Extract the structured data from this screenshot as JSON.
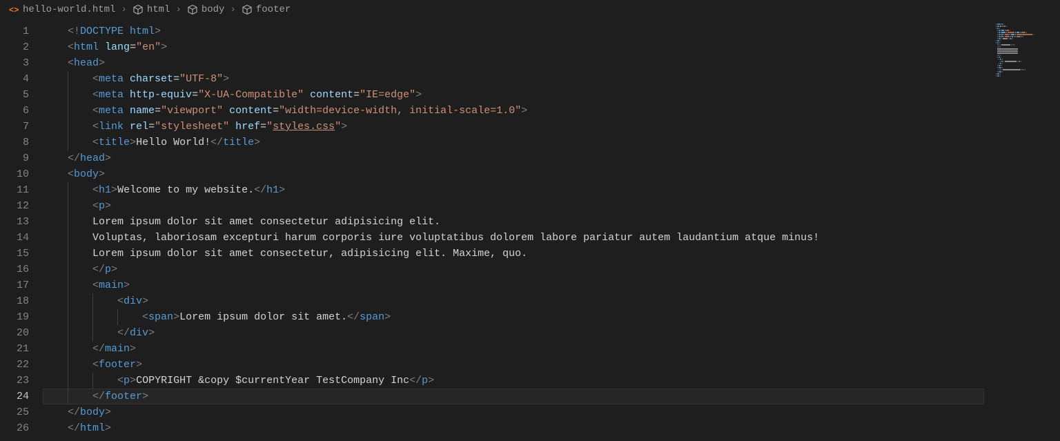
{
  "breadcrumb": {
    "file": "hello-world.html",
    "path": [
      "html",
      "body",
      "footer"
    ]
  },
  "lines": [
    {
      "n": 1,
      "indent": 0,
      "tokens": [
        [
          "<!",
          "gray"
        ],
        [
          "DOCTYPE ",
          "doctype"
        ],
        [
          "html",
          "blue"
        ],
        [
          ">",
          "gray"
        ]
      ]
    },
    {
      "n": 2,
      "indent": 0,
      "tokens": [
        [
          "<",
          "gray"
        ],
        [
          "html ",
          "blue"
        ],
        [
          "lang",
          "lblue"
        ],
        [
          "=",
          "text"
        ],
        [
          "\"en\"",
          "orange"
        ],
        [
          ">",
          "gray"
        ]
      ]
    },
    {
      "n": 3,
      "indent": 0,
      "tokens": [
        [
          "<",
          "gray"
        ],
        [
          "head",
          "blue"
        ],
        [
          ">",
          "gray"
        ]
      ]
    },
    {
      "n": 4,
      "indent": 1,
      "tokens": [
        [
          "<",
          "gray"
        ],
        [
          "meta ",
          "blue"
        ],
        [
          "charset",
          "lblue"
        ],
        [
          "=",
          "text"
        ],
        [
          "\"UTF-8\"",
          "orange"
        ],
        [
          ">",
          "gray"
        ]
      ]
    },
    {
      "n": 5,
      "indent": 1,
      "tokens": [
        [
          "<",
          "gray"
        ],
        [
          "meta ",
          "blue"
        ],
        [
          "http-equiv",
          "lblue"
        ],
        [
          "=",
          "text"
        ],
        [
          "\"X-UA-Compatible\"",
          "orange"
        ],
        [
          " ",
          "text"
        ],
        [
          "content",
          "lblue"
        ],
        [
          "=",
          "text"
        ],
        [
          "\"IE=edge\"",
          "orange"
        ],
        [
          ">",
          "gray"
        ]
      ]
    },
    {
      "n": 6,
      "indent": 1,
      "tokens": [
        [
          "<",
          "gray"
        ],
        [
          "meta ",
          "blue"
        ],
        [
          "name",
          "lblue"
        ],
        [
          "=",
          "text"
        ],
        [
          "\"viewport\"",
          "orange"
        ],
        [
          " ",
          "text"
        ],
        [
          "content",
          "lblue"
        ],
        [
          "=",
          "text"
        ],
        [
          "\"width=device-width, initial-scale=1.0\"",
          "orange"
        ],
        [
          ">",
          "gray"
        ]
      ]
    },
    {
      "n": 7,
      "indent": 1,
      "tokens": [
        [
          "<",
          "gray"
        ],
        [
          "link ",
          "blue"
        ],
        [
          "rel",
          "lblue"
        ],
        [
          "=",
          "text"
        ],
        [
          "\"stylesheet\"",
          "orange"
        ],
        [
          " ",
          "text"
        ],
        [
          "href",
          "lblue"
        ],
        [
          "=",
          "text"
        ],
        [
          "\"",
          "orange"
        ],
        [
          "styles.css",
          "orange underline"
        ],
        [
          "\"",
          "orange"
        ],
        [
          ">",
          "gray"
        ]
      ]
    },
    {
      "n": 8,
      "indent": 1,
      "tokens": [
        [
          "<",
          "gray"
        ],
        [
          "title",
          "blue"
        ],
        [
          ">",
          "gray"
        ],
        [
          "Hello World!",
          "text"
        ],
        [
          "</",
          "gray"
        ],
        [
          "title",
          "blue"
        ],
        [
          ">",
          "gray"
        ]
      ]
    },
    {
      "n": 9,
      "indent": 0,
      "tokens": [
        [
          "</",
          "gray"
        ],
        [
          "head",
          "blue"
        ],
        [
          ">",
          "gray"
        ]
      ]
    },
    {
      "n": 10,
      "indent": 0,
      "tokens": [
        [
          "<",
          "gray"
        ],
        [
          "body",
          "blue"
        ],
        [
          ">",
          "gray"
        ]
      ]
    },
    {
      "n": 11,
      "indent": 1,
      "tokens": [
        [
          "<",
          "gray"
        ],
        [
          "h1",
          "blue"
        ],
        [
          ">",
          "gray"
        ],
        [
          "Welcome to my website.",
          "text"
        ],
        [
          "</",
          "gray"
        ],
        [
          "h1",
          "blue"
        ],
        [
          ">",
          "gray"
        ]
      ]
    },
    {
      "n": 12,
      "indent": 1,
      "tokens": [
        [
          "<",
          "gray"
        ],
        [
          "p",
          "blue"
        ],
        [
          ">",
          "gray"
        ]
      ]
    },
    {
      "n": 13,
      "indent": 1,
      "tokens": [
        [
          "Lorem ipsum dolor sit amet consectetur adipisicing elit.",
          "text"
        ]
      ]
    },
    {
      "n": 14,
      "indent": 1,
      "tokens": [
        [
          "Voluptas, laboriosam excepturi harum corporis iure voluptatibus dolorem labore pariatur autem laudantium atque minus!",
          "text"
        ]
      ]
    },
    {
      "n": 15,
      "indent": 1,
      "tokens": [
        [
          "Lorem ipsum dolor sit amet consectetur, adipisicing elit. Maxime, quo.",
          "text"
        ]
      ]
    },
    {
      "n": 16,
      "indent": 1,
      "tokens": [
        [
          "</",
          "gray"
        ],
        [
          "p",
          "blue"
        ],
        [
          ">",
          "gray"
        ]
      ]
    },
    {
      "n": 17,
      "indent": 1,
      "tokens": [
        [
          "<",
          "gray"
        ],
        [
          "main",
          "blue"
        ],
        [
          ">",
          "gray"
        ]
      ]
    },
    {
      "n": 18,
      "indent": 2,
      "tokens": [
        [
          "<",
          "gray"
        ],
        [
          "div",
          "blue"
        ],
        [
          ">",
          "gray"
        ]
      ]
    },
    {
      "n": 19,
      "indent": 3,
      "tokens": [
        [
          "<",
          "gray"
        ],
        [
          "span",
          "blue"
        ],
        [
          ">",
          "gray"
        ],
        [
          "Lorem ipsum dolor sit amet.",
          "text"
        ],
        [
          "</",
          "gray"
        ],
        [
          "span",
          "blue"
        ],
        [
          ">",
          "gray"
        ]
      ]
    },
    {
      "n": 20,
      "indent": 2,
      "tokens": [
        [
          "</",
          "gray"
        ],
        [
          "div",
          "blue"
        ],
        [
          ">",
          "gray"
        ]
      ]
    },
    {
      "n": 21,
      "indent": 1,
      "tokens": [
        [
          "</",
          "gray"
        ],
        [
          "main",
          "blue"
        ],
        [
          ">",
          "gray"
        ]
      ]
    },
    {
      "n": 22,
      "indent": 1,
      "tokens": [
        [
          "<",
          "gray"
        ],
        [
          "footer",
          "blue"
        ],
        [
          ">",
          "gray"
        ]
      ]
    },
    {
      "n": 23,
      "indent": 2,
      "tokens": [
        [
          "<",
          "gray"
        ],
        [
          "p",
          "blue"
        ],
        [
          ">",
          "gray"
        ],
        [
          "COPYRIGHT &copy $currentYear TestCompany Inc",
          "text"
        ],
        [
          "</",
          "gray"
        ],
        [
          "p",
          "blue"
        ],
        [
          ">",
          "gray"
        ]
      ]
    },
    {
      "n": 24,
      "indent": 1,
      "tokens": [
        [
          "</",
          "gray"
        ],
        [
          "footer",
          "blue"
        ],
        [
          ">",
          "gray"
        ]
      ],
      "current": true
    },
    {
      "n": 25,
      "indent": 0,
      "tokens": [
        [
          "</",
          "gray"
        ],
        [
          "body",
          "blue"
        ],
        [
          ">",
          "gray"
        ]
      ]
    },
    {
      "n": 26,
      "indent": 0,
      "tokens": [
        [
          "</",
          "gray"
        ],
        [
          "html",
          "blue"
        ],
        [
          ">",
          "gray"
        ]
      ]
    }
  ],
  "indentUnit": "    ",
  "baseIndent": "    "
}
